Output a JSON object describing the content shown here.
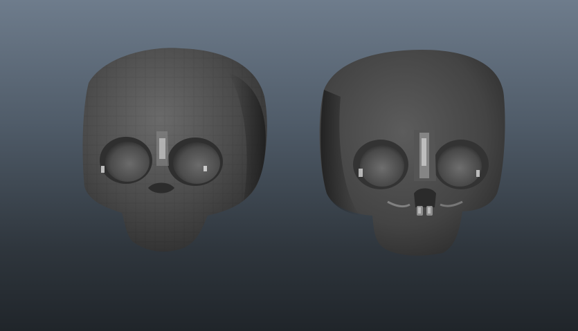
{
  "viewport": {
    "background_top": "#6e7c8c",
    "background_bottom": "#20252a"
  },
  "models": [
    {
      "name": "low-poly-skull",
      "shading": "faceted",
      "base_color": "#4a4a4a"
    },
    {
      "name": "smooth-skull",
      "shading": "smooth",
      "base_color": "#474747"
    }
  ]
}
